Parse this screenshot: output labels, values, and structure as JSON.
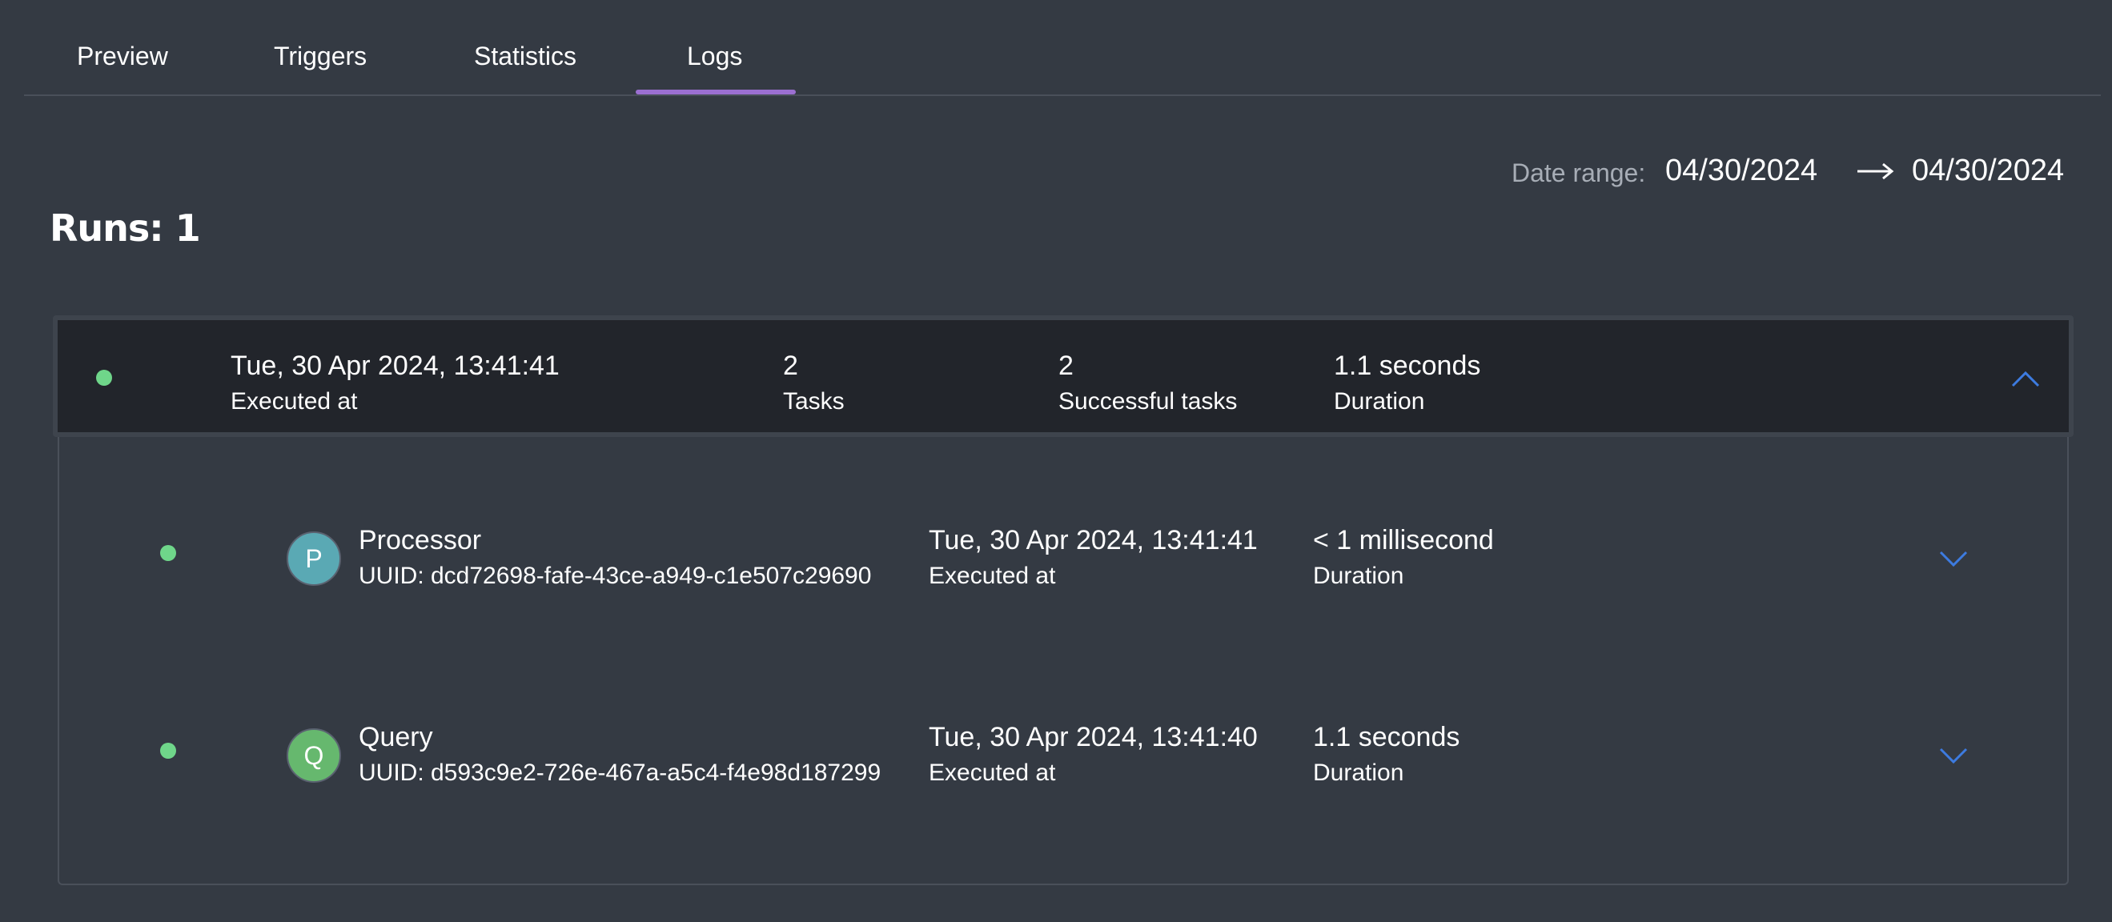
{
  "tabs": [
    {
      "label": "Preview"
    },
    {
      "label": "Triggers"
    },
    {
      "label": "Statistics"
    },
    {
      "label": "Logs",
      "active": true
    }
  ],
  "date_range": {
    "label": "Date range:",
    "start": "04/30/2024",
    "end": "04/30/2024"
  },
  "runs_title": "Runs: 1",
  "run": {
    "status_color": "#6fd68a",
    "executed_at": "Tue, 30 Apr 2024, 13:41:41",
    "executed_at_label": "Executed at",
    "tasks": "2",
    "tasks_label": "Tasks",
    "successful_tasks": "2",
    "successful_tasks_label": "Successful tasks",
    "duration": "1.1 seconds",
    "duration_label": "Duration",
    "expand_icon": "chevron-up-icon"
  },
  "tasks": [
    {
      "avatar_letter": "P",
      "avatar_color": "#5aa9b4",
      "name": "Processor",
      "uuid": "UUID: dcd72698-fafe-43ce-a949-c1e507c29690",
      "executed_at": "Tue, 30 Apr 2024, 13:41:41",
      "executed_at_label": "Executed at",
      "duration": "< 1 millisecond",
      "duration_label": "Duration",
      "expand_icon": "chevron-down-icon"
    },
    {
      "avatar_letter": "Q",
      "avatar_color": "#66b86e",
      "name": "Query",
      "uuid": "UUID: d593c9e2-726e-467a-a5c4-f4e98d187299",
      "executed_at": "Tue, 30 Apr 2024, 13:41:40",
      "executed_at_label": "Executed at",
      "duration": "1.1 seconds",
      "duration_label": "Duration",
      "expand_icon": "chevron-down-icon"
    }
  ],
  "colors": {
    "background": "#343a43",
    "accent_tab": "#9b6fd1",
    "chevron": "#3d7be0",
    "success": "#6fd68a"
  }
}
